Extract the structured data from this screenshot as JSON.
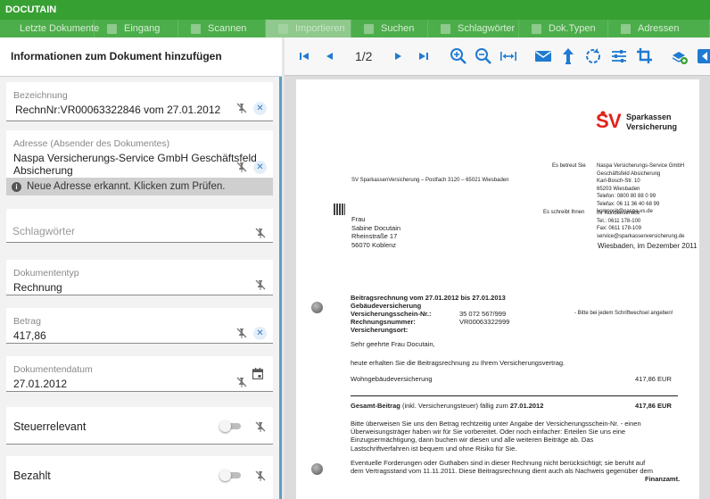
{
  "app": {
    "title": "DOCUTAIN"
  },
  "nav": {
    "tabs": [
      {
        "label": "Letzte Dokumente",
        "icon": "document-icon"
      },
      {
        "label": "Eingang",
        "icon": "inbox-icon"
      },
      {
        "label": "Scannen",
        "icon": "scan-icon"
      },
      {
        "label": "Importieren",
        "icon": "import-icon"
      },
      {
        "label": "Suchen",
        "icon": "search-icon"
      },
      {
        "label": "Schlagwörter",
        "icon": "tag-icon"
      },
      {
        "label": "Dok.Typen",
        "icon": "doctype-icon"
      },
      {
        "label": "Adressen",
        "icon": "address-icon"
      }
    ]
  },
  "panel": {
    "title": "Informationen zum Dokument hinzufügen",
    "bezeichnung": {
      "label": "Bezeichnung",
      "value": "RechnNr:VR00063322846 vom 27.01.2012"
    },
    "adresse": {
      "label": "Adresse (Absender des Dokumentes)",
      "line1": "Naspa Versicherungs-Service GmbH Geschäftsfeld",
      "line2": "Absicherung"
    },
    "notice": "Neue Adresse erkannt. Klicken zum Prüfen.",
    "schlagwoerter": {
      "placeholder": "Schlagwörter"
    },
    "dokumententyp": {
      "label": "Dokumententyp",
      "value": "Rechnung"
    },
    "betrag": {
      "label": "Betrag",
      "value": "417,86"
    },
    "datum": {
      "label": "Dokumentendatum",
      "value": "27.01.2012"
    },
    "steuerrelevant": {
      "label": "Steuerrelevant",
      "on": false
    },
    "bezahlt": {
      "label": "Bezahlt",
      "on": false
    }
  },
  "viewer": {
    "page": "1/2",
    "colors": {
      "icon_blue": "#1f7bd1",
      "accent_green": "#37a033"
    }
  },
  "document": {
    "brand1": "Sparkassen",
    "brand2": "Versicherung",
    "return_line": "SV SparkassenVersicherung – Postfach 3120 – 65021 Wiesbaden",
    "betreut_label": "Es betreut Sie",
    "betreut": [
      "Naspa Versicherungs-Service GmbH",
      "Geschäftsfeld Absicherung",
      "Karl-Bosch-Str. 10",
      "65203 Wiesbaden",
      "Telefon: 0800 80 88 0 99",
      "Telefax: 06 11 36 40 68 99",
      "komposit@naspa-vs.de"
    ],
    "schreibt_label": "Es schreibt Ihnen",
    "schreibt": [
      "Ihr Kundenservice",
      "Tel.:        0611 178-100",
      "Fax:         0611 178-109",
      "service@sparkassenversicherung.de"
    ],
    "recipient": [
      "Frau",
      "Sabine Docutain",
      "Rheinstraße 17",
      "56070 Koblenz"
    ],
    "ort_datum": "Wiesbaden, im Dezember 2011",
    "head1": "Beitragsrechnung vom   27.01.2012   bis   27.01.2013",
    "head2": "Gebäudeversicherung",
    "head3": "Versicherungsschein-Nr.:",
    "head3_val": "35 072 567/999",
    "head3_note": "- Bitte bei jedem Schriftwechsel angeben!",
    "head4": "Rechnungsnummer:",
    "head4_val": "VR00063322999",
    "head5": "Versicherungsort:",
    "greeting": "Sehr geehrte Frau Docutain,",
    "intro": "heute erhalten Sie die Beitragsrechnung zu Ihrem Versicherungsvertrag.",
    "item_label": "Wohngebäudeversicherung",
    "item_amount": "417,86 EUR",
    "total_label": "Gesamt-Beitrag",
    "total_mid": "(inkl. Versicherungsteuer) fällig zum",
    "total_date": "27.01.2012",
    "total_amount": "417,86 EUR",
    "para1": [
      "Bitte überweisen Sie uns den Betrag rechtzeitig unter Angabe der Versicherungsschein-Nr. - einen",
      "Überweisungsträger haben wir für Sie vorbereitet. Oder noch einfacher: Erteilen Sie uns eine",
      "Einzugsermächtigung, dann buchen wir diesen und alle weiteren Beiträge ab. Das",
      "Lastschriftverfahren ist bequem und ohne Risiko für Sie."
    ],
    "para2": [
      "Eventuelle Forderungen oder Guthaben sind in dieser Rechnung nicht berücksichtigt; sie beruht auf",
      "dem Vertragsstand vom 11.11.2011. Diese Beitragsrechnung dient auch als Nachweis gegenüber dem"
    ],
    "para2_end": "Finanzamt."
  }
}
